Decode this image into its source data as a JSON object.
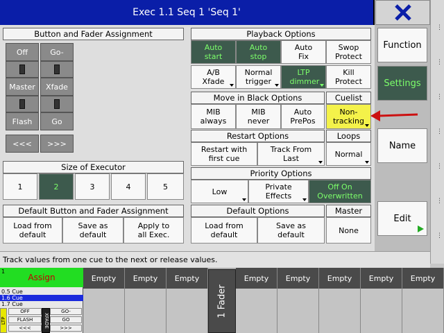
{
  "title": "Exec 1.1 Seq 1 'Seq 1'",
  "side": {
    "function": "Function",
    "settings": "Settings",
    "name": "Name",
    "edit": "Edit"
  },
  "button_fader": {
    "header": "Button and Fader Assignment",
    "off": "Off",
    "go_minus": "Go-",
    "master": "Master",
    "xfade": "Xfade",
    "flash": "Flash",
    "go": "Go",
    "back": "<<<",
    "fwd": ">>>"
  },
  "size": {
    "header": "Size of Executor",
    "options": [
      "1",
      "2",
      "3",
      "4",
      "5"
    ],
    "selected": "2"
  },
  "default_bf": {
    "header": "Default Button and Fader Assignment",
    "load": "Load from default",
    "save": "Save as default",
    "apply": "Apply to all Exec."
  },
  "playback": {
    "header": "Playback Options",
    "auto_start": "Auto start",
    "auto_stop": "Auto stop",
    "auto_fix": "Auto Fix",
    "swop_protect": "Swop Protect",
    "ab_xfade": "A/B Xfade",
    "normal_trigger": "Normal trigger",
    "ltp_dimmer": "LTP dimmer",
    "kill_protect": "Kill Protect"
  },
  "mib": {
    "header": "Move in Black Options",
    "always": "MIB always",
    "never": "MIB never",
    "auto_prepos": "Auto PrePos"
  },
  "cuelist": {
    "header": "Cuelist",
    "value": "Non-tracking"
  },
  "restart": {
    "header": "Restart Options",
    "first_cue": "Restart with first cue",
    "track_last": "Track From Last"
  },
  "loops": {
    "header": "Loops",
    "value": "Normal"
  },
  "priority": {
    "header": "Priority Options",
    "low": "Low",
    "private_effects": "Private Effects",
    "off_on": "Off On Overwritten"
  },
  "default_opts": {
    "header": "Default Options",
    "load": "Load from default",
    "save": "Save as default"
  },
  "master": {
    "header": "Master",
    "value": "None"
  },
  "status": "Track values from one cue to the next or release values.",
  "bottom": {
    "assign_label": "Assign",
    "assign_num": "1",
    "cues": [
      "0.5 Cue",
      "1.6 Cue",
      "1.7 Cue"
    ],
    "mini": {
      "ltp": "LTP",
      "off": "OFF",
      "go_minus": "GO-",
      "flash": "FLASH",
      "go": "GO",
      "back": "<<<",
      "fwd": ">>>",
      "xfade": "XFADE"
    },
    "fader_label": "1 Fader",
    "empty": [
      "Empty",
      "Empty",
      "Empty",
      "Empty",
      "Empty",
      "Empty",
      "Empty",
      "Empty",
      "Empty"
    ]
  },
  "colors": {
    "title_bg": "#0a1ea8",
    "active_bg": "#3d5a4d",
    "active_text": "#7cff6a",
    "highlight": "#f4f24a",
    "assign_bg": "#22dd22"
  },
  "icons": {
    "close": "close-icon",
    "edit": "play-triangle-icon",
    "arrow": "red-arrow-icon"
  }
}
